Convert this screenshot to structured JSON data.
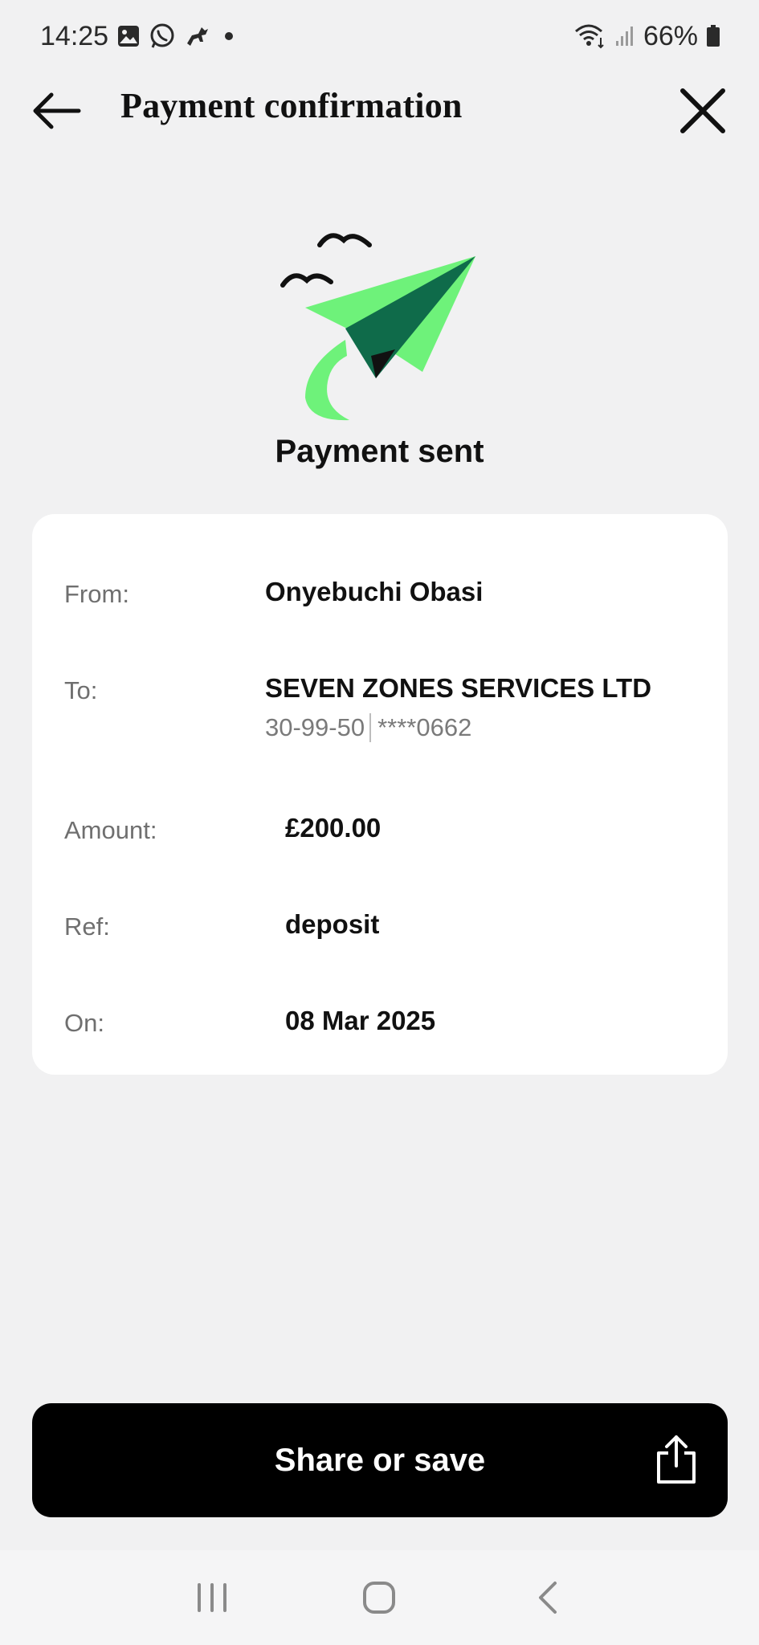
{
  "status_bar": {
    "time": "14:25",
    "battery": "66%",
    "icons": [
      "gallery-icon",
      "whatsapp-icon",
      "horse-icon",
      "dot-icon",
      "wifi-icon",
      "signal-icon",
      "battery-icon"
    ]
  },
  "header": {
    "title": "Payment confirmation",
    "back_icon": "arrow-left-icon",
    "close_icon": "close-icon"
  },
  "illustration": {
    "icon": "paper-plane-icon",
    "colors": {
      "plane_light": "#6ef27a",
      "plane_dark": "#0f6b4a",
      "birds": "#111111"
    }
  },
  "status_title": "Payment sent",
  "details": {
    "from": {
      "label": "From:",
      "value": "Onyebuchi Obasi"
    },
    "to": {
      "label": "To:",
      "value": "SEVEN ZONES SERVICES LTD",
      "sort_code": "30-99-50",
      "account": "****0662"
    },
    "amount": {
      "label": "Amount:",
      "value": "£200.00"
    },
    "ref": {
      "label": "Ref:",
      "value": "deposit"
    },
    "on": {
      "label": "On:",
      "value": "08 Mar 2025"
    }
  },
  "share_button": {
    "label": "Share or save",
    "icon": "share-icon"
  },
  "nav_bar": {
    "icons": [
      "recent-apps-icon",
      "home-icon",
      "back-nav-icon"
    ]
  }
}
